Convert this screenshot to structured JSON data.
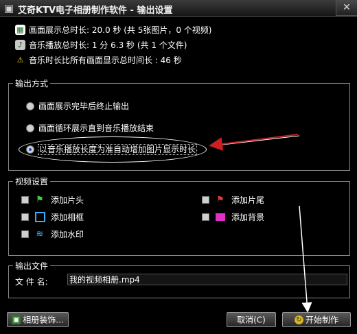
{
  "window": {
    "title": "艾奇KTV电子相册制作软件 - 输出设置",
    "close_glyph": "✕"
  },
  "info": {
    "display_duration": "画面展示总时长: 20.0 秒 (共 5张图片，0 个视频)",
    "music_duration": "音乐播放总时长: 1 分 6.3 秒 (共 1 个文件)",
    "warning": "音乐时长比所有画面显示总时间长 : 46 秒"
  },
  "output_mode": {
    "legend": "输出方式",
    "options": [
      {
        "label": "画面展示完毕后终止输出",
        "selected": false
      },
      {
        "label": "画面循环展示直到音乐播放结束",
        "selected": false
      },
      {
        "label": "以音乐播放长度为准自动增加图片显示时长",
        "selected": true
      }
    ]
  },
  "video_settings": {
    "legend": "视频设置",
    "items": [
      {
        "label": "添加片头",
        "icon": "green-flag-icon"
      },
      {
        "label": "添加片尾",
        "icon": "red-flag-icon"
      },
      {
        "label": "添加相框",
        "icon": "frame-icon"
      },
      {
        "label": "添加背景",
        "icon": "background-icon"
      },
      {
        "label": "添加水印",
        "icon": "watermark-icon"
      }
    ]
  },
  "output_file": {
    "legend": "输出文件",
    "label": "文 件 名:",
    "value": "我的视频相册.mp4"
  },
  "buttons": {
    "decorate": "相册装饰...",
    "cancel": "取消(C)",
    "start": "开始制作"
  },
  "colors": {
    "accent_arrow": "#cc1f1f",
    "annotation": "#ffffff"
  }
}
